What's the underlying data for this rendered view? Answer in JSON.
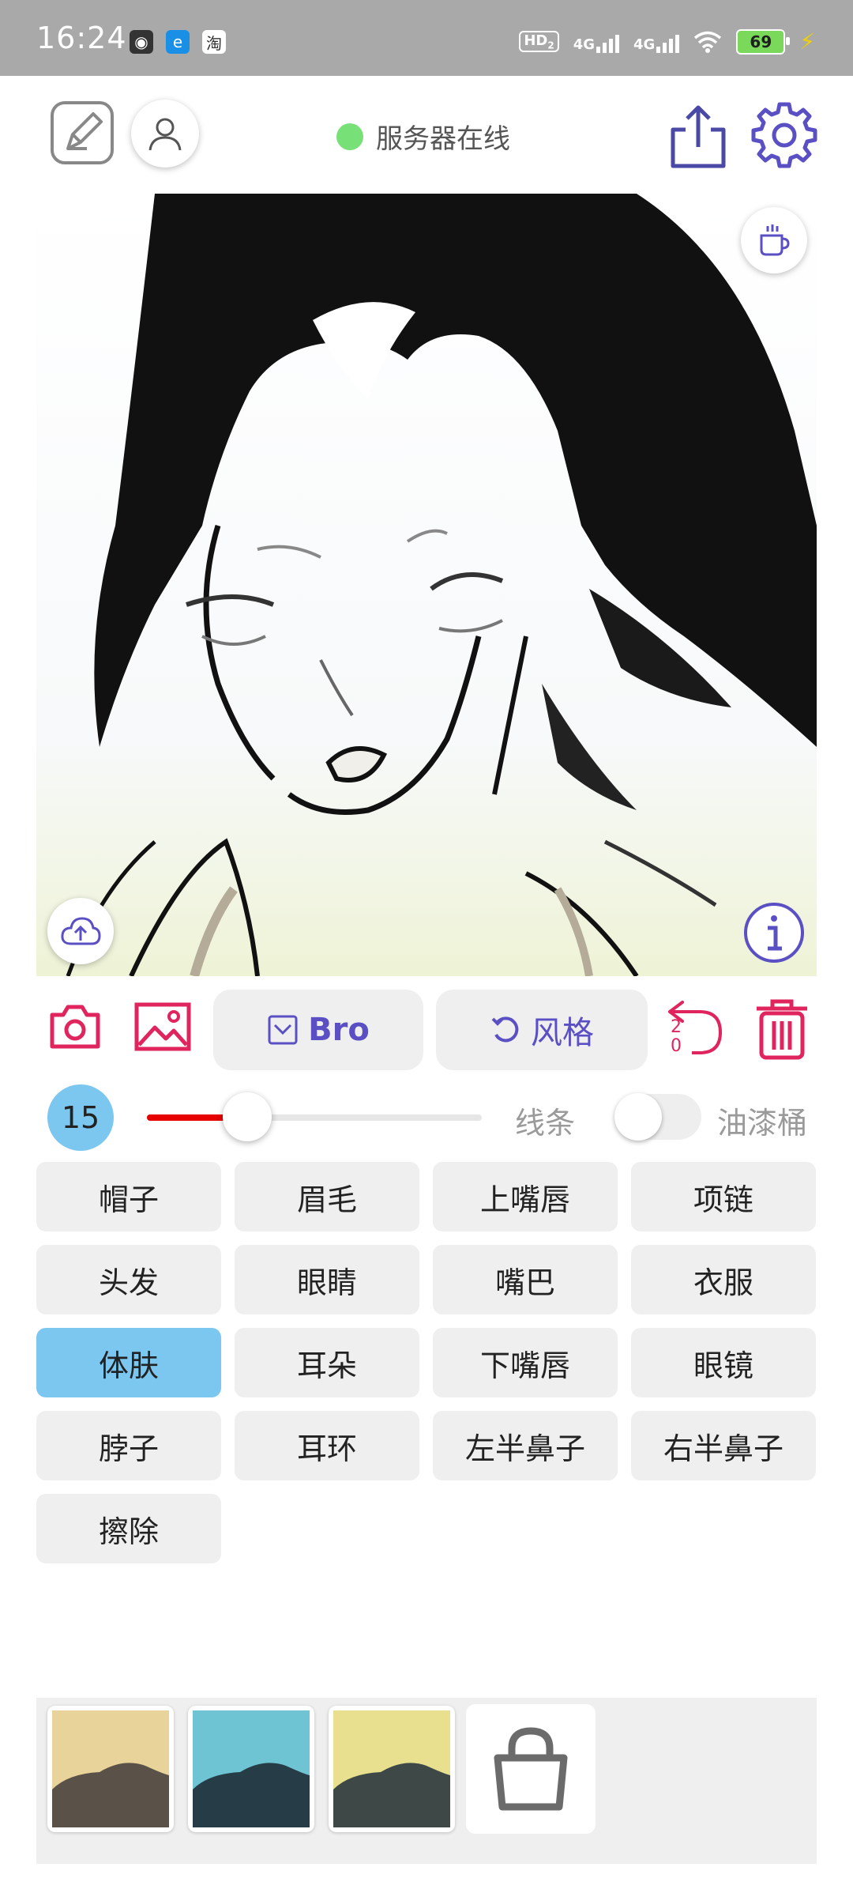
{
  "status_bar": {
    "time": "16:24",
    "apps": [
      "app-icon-1",
      "app-icon-2",
      "淘"
    ],
    "hd": "HD",
    "hd_sub": "2",
    "net1": "4G",
    "net2": "4G",
    "battery": "69"
  },
  "header": {
    "server_status": "服务器在线",
    "status_color": "#77e077"
  },
  "tools": {
    "bro_label": "Bro",
    "style_label": "风格",
    "undo_count": "2\n0"
  },
  "brush": {
    "size": "15",
    "slider_value": 0.3,
    "line_label": "线条",
    "bucket_label": "油漆桶",
    "bucket_enabled": false
  },
  "parts": [
    {
      "label": "帽子",
      "selected": false
    },
    {
      "label": "眉毛",
      "selected": false
    },
    {
      "label": "上嘴唇",
      "selected": false
    },
    {
      "label": "项链",
      "selected": false
    },
    {
      "label": "头发",
      "selected": false
    },
    {
      "label": "眼睛",
      "selected": false
    },
    {
      "label": "嘴巴",
      "selected": false
    },
    {
      "label": "衣服",
      "selected": false
    },
    {
      "label": "体肤",
      "selected": true
    },
    {
      "label": "耳朵",
      "selected": false
    },
    {
      "label": "下嘴唇",
      "selected": false
    },
    {
      "label": "眼镜",
      "selected": false
    },
    {
      "label": "脖子",
      "selected": false
    },
    {
      "label": "耳环",
      "selected": false
    },
    {
      "label": "左半鼻子",
      "selected": false
    },
    {
      "label": "右半鼻子",
      "selected": false
    },
    {
      "label": "擦除",
      "selected": false
    }
  ],
  "tray": {
    "swatches": [
      {
        "sky": "#e8d39a",
        "ground": "#5a5148"
      },
      {
        "sky": "#6fc4d4",
        "ground": "#263c46"
      },
      {
        "sky": "#e8e08e",
        "ground": "#3d4847"
      }
    ]
  },
  "colors": {
    "accent": "#5b4fc4",
    "danger": "#e0245e",
    "selected": "#7cc7ef"
  }
}
